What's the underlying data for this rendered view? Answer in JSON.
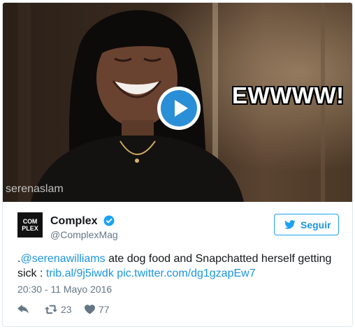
{
  "media": {
    "overlay_text": "EWWWW!",
    "watermark": "serenaslam"
  },
  "author": {
    "display_name": "Complex",
    "handle": "@ComplexMag",
    "logo_text_top": "COM",
    "logo_text_bottom": "PLEX",
    "verified": true
  },
  "follow": {
    "label": "Seguir"
  },
  "tweet": {
    "prefix": ".",
    "mention": "@serenawilliams",
    "body": " ate dog food and Snapchatted herself getting sick : ",
    "link1": "trib.al/9j5iwdk",
    "link2": "pic.twitter.com/dg1gzapEw7",
    "timestamp": "20:30 - 11 Mayo 2016"
  },
  "actions": {
    "retweets": "23",
    "likes": "77"
  },
  "colors": {
    "link_blue": "#1b95e0",
    "play_blue": "#2a8fd6",
    "text_dark": "#14171a",
    "text_gray": "#657786"
  },
  "icons": [
    "play-icon",
    "verified-icon",
    "twitter-bird-icon",
    "reply-icon",
    "retweet-icon",
    "heart-icon"
  ]
}
